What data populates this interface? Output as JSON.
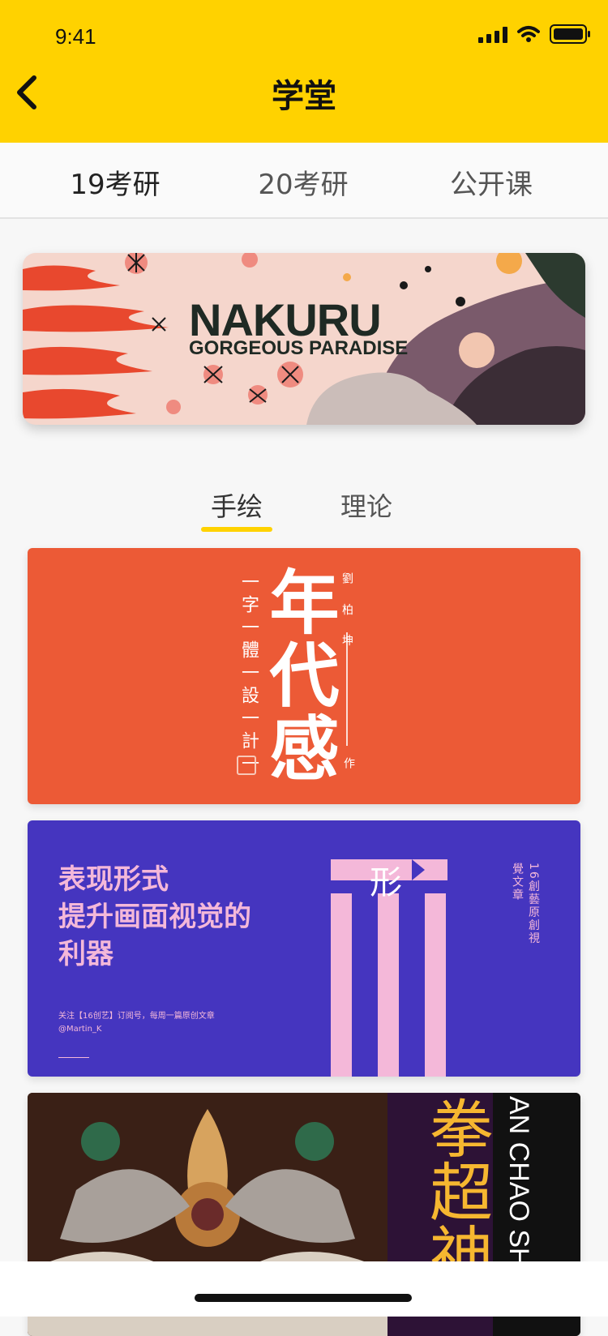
{
  "status_bar": {
    "time": "9:41"
  },
  "nav": {
    "title": "学堂"
  },
  "top_tabs": [
    "19考研",
    "20考研",
    "公开课"
  ],
  "banner": {
    "title": "NAKURU",
    "subtitle": "GORGEOUS PARADISE"
  },
  "sub_tabs": [
    "手绘",
    "理论"
  ],
  "cards": [
    {
      "big_title": "年代感",
      "side_text": "一字一體一設一計一",
      "author": "劉 柏 坤",
      "author_suffix": "作"
    },
    {
      "heading_line1": "表现形式",
      "heading_line2": "提升画面视觉的",
      "heading_line3": "利器",
      "footnote_line1": "关注【16创艺】订阅号，每周一篇原创文章",
      "footnote_line2": "@Martin_K",
      "glyph": "形",
      "vertical_text": "16創藝原創視覺文章"
    },
    {
      "vertical_chars": "拳超神",
      "vertical_latin": "AN CHAO SH"
    }
  ],
  "colors": {
    "header": "#ffd200",
    "card1": "#ec5a36",
    "card2": "#4535bf",
    "pink": "#f4b8d9"
  }
}
